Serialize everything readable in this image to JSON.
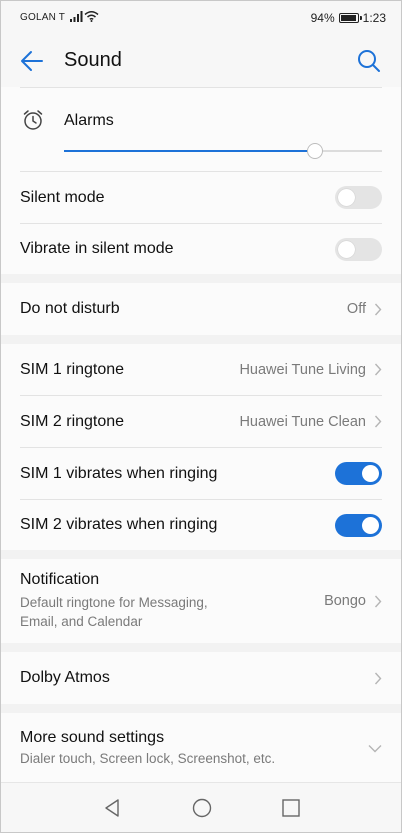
{
  "status_bar": {
    "carrier": "GOLAN T",
    "battery_percent_text": "94%",
    "battery_level": 0.94,
    "time": "1:23"
  },
  "app_bar": {
    "title": "Sound",
    "back_icon": "back-arrow-icon",
    "search_icon": "search-icon"
  },
  "alarms": {
    "label": "Alarms",
    "icon": "alarm-clock-icon",
    "volume_level": 0.79
  },
  "toggles": {
    "silent_mode": {
      "label": "Silent mode",
      "on": false
    },
    "vibrate_silent": {
      "label": "Vibrate in silent mode",
      "on": false
    },
    "sim1_vibrate": {
      "label": "SIM 1 vibrates when ringing",
      "on": true
    },
    "sim2_vibrate": {
      "label": "SIM 2 vibrates when ringing",
      "on": true
    }
  },
  "dnd": {
    "label": "Do not disturb",
    "value": "Off"
  },
  "sim1_ringtone": {
    "label": "SIM 1 ringtone",
    "value": "Huawei Tune Living"
  },
  "sim2_ringtone": {
    "label": "SIM 2 ringtone",
    "value": "Huawei Tune Clean"
  },
  "notification": {
    "label": "Notification",
    "sublabel_line1": "Default ringtone for Messaging,",
    "sublabel_line2": "Email, and Calendar",
    "value": "Bongo"
  },
  "dolby": {
    "label": "Dolby Atmos"
  },
  "more_sound": {
    "label": "More sound settings",
    "sublabel": "Dialer touch, Screen lock, Screenshot, etc."
  },
  "colors": {
    "accent": "#1d72d8",
    "background": "#f2f2f2",
    "card": "#fbfbfb",
    "secondary_text": "#7a7a7a"
  }
}
